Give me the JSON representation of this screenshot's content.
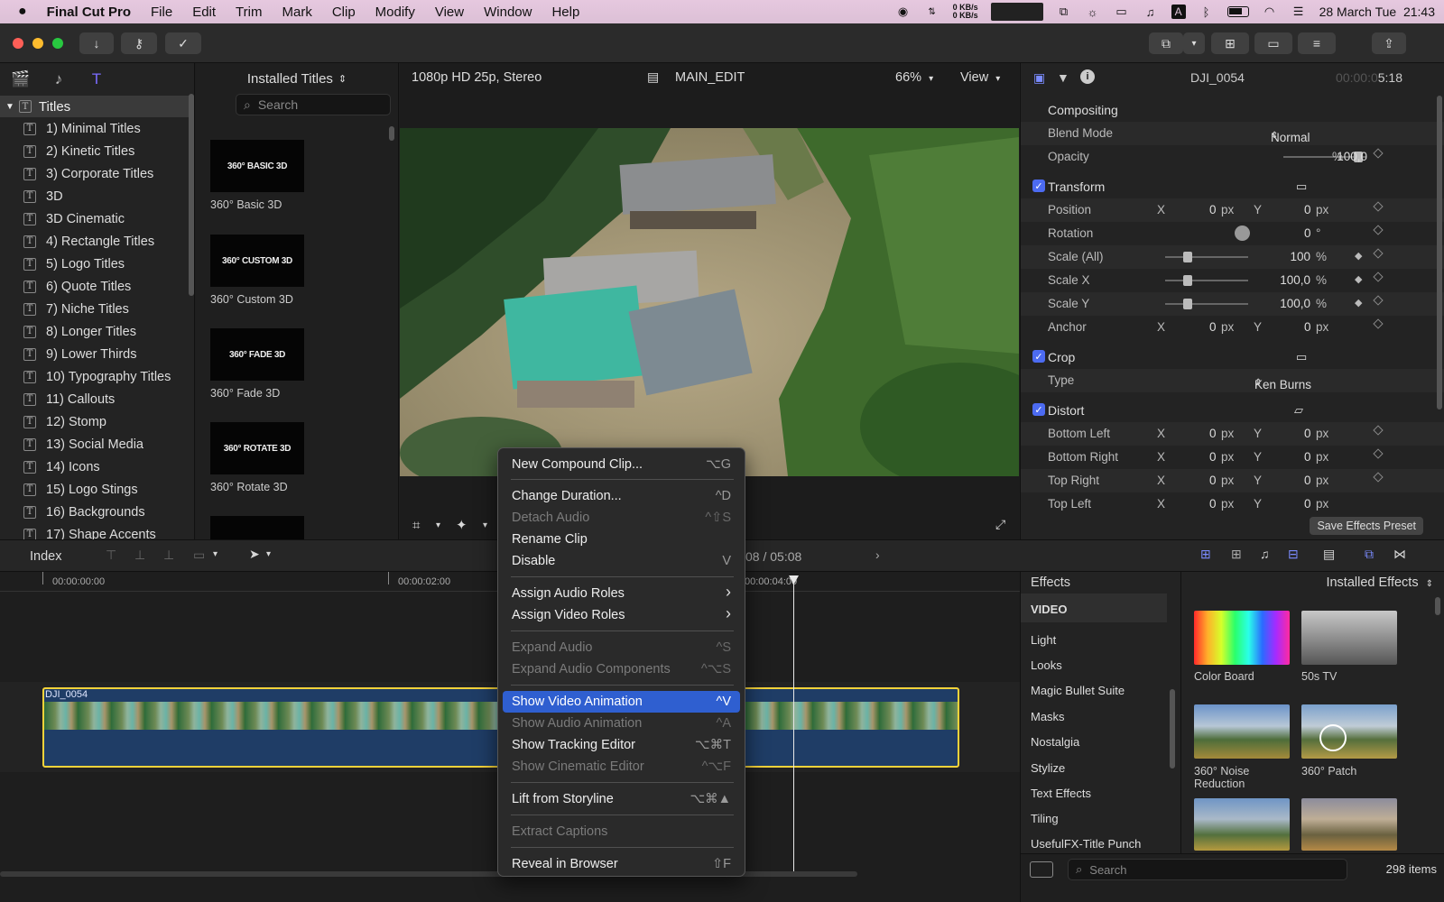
{
  "menubar": {
    "app": "Final Cut Pro",
    "items": [
      "File",
      "Edit",
      "Trim",
      "Mark",
      "Clip",
      "Modify",
      "View",
      "Window",
      "Help"
    ],
    "net_up": "0 KB/s",
    "net_down": "0 KB/s",
    "keyboard": "A",
    "datetime": "28 March Tue  21:43"
  },
  "sidebar": {
    "root": "Titles",
    "items": [
      "1) Minimal Titles",
      "2) Kinetic Titles",
      "3) Corporate Titles",
      "3D",
      "3D Cinematic",
      "4) Rectangle Titles",
      "5) Logo Titles",
      "6) Quote Titles",
      "7) Niche Titles",
      "8) Longer Titles",
      "9) Lower Thirds",
      "10) Typography Titles",
      "11) Callouts",
      "12) Stomp",
      "13) Social Media",
      "14) Icons",
      "15) Logo Stings",
      "16) Backgrounds",
      "17) Shape Accents"
    ]
  },
  "titles_browser": {
    "header": "Installed Titles",
    "search_placeholder": "Search",
    "thumbs": [
      {
        "thumb_text": "360° BASIC 3D",
        "label": "360° Basic 3D"
      },
      {
        "thumb_text": "360° CUSTOM 3D",
        "label": "360° Custom 3D"
      },
      {
        "thumb_text": "360° FADE 3D",
        "label": "360° Fade 3D"
      },
      {
        "thumb_text": "360° ROTATE 3D",
        "label": "360° Rotate 3D"
      }
    ]
  },
  "viewer": {
    "format": "1080p HD 25p, Stereo",
    "project": "MAIN_EDIT",
    "zoom": "66%",
    "view_label": "View"
  },
  "inspector": {
    "clip_name": "DJI_0054",
    "timecode_dim": "00:00:0",
    "timecode": "5:18",
    "compositing": "Compositing",
    "blend_mode_label": "Blend Mode",
    "blend_mode_value": "Normal",
    "opacity_label": "Opacity",
    "opacity_value": "100,0",
    "opacity_level": 0.9,
    "transform": "Transform",
    "position_label": "Position",
    "position_x": "0",
    "position_y": "0",
    "rotation_label": "Rotation",
    "rotation_value": "0",
    "scale_all_label": "Scale (All)",
    "scale_all_value": "100",
    "scale_x_label": "Scale X",
    "scale_x_value": "100,0",
    "scale_y_label": "Scale Y",
    "scale_y_value": "100,0",
    "anchor_label": "Anchor",
    "anchor_x": "0",
    "anchor_y": "0",
    "crop": "Crop",
    "type_label": "Type",
    "type_value": "Ken Burns",
    "distort": "Distort",
    "bottom_left": "Bottom Left",
    "bottom_right": "Bottom Right",
    "top_right": "Top Right",
    "top_left": "Top Left",
    "zero": "0",
    "x": "X",
    "y": "Y",
    "px": "px",
    "pct": "%",
    "deg": "°",
    "save_preset": "Save Effects Preset"
  },
  "timeline": {
    "index_label": "Index",
    "timecode_partial": "08 / 05:08",
    "ruler": [
      "00:00:00:00",
      "00:00:02:00",
      "00:00:04:00"
    ],
    "clip_name": "DJI_0054"
  },
  "effects": {
    "title": "Effects",
    "header": "Installed Effects",
    "categories": [
      "VIDEO",
      "Light",
      "Looks",
      "Magic Bullet Suite",
      "Masks",
      "Nostalgia",
      "Stylize",
      "Text Effects",
      "Tiling",
      "UsefulFX-Title Punch"
    ],
    "thumbs": [
      "Color Board",
      "50s TV",
      "360° Noise Reduction",
      "360° Patch"
    ],
    "search_placeholder": "Search",
    "count": "298 items"
  },
  "context_menu": {
    "items": [
      {
        "label": "New Compound Clip...",
        "shortcut": "⌥G",
        "disabled": false
      },
      {
        "label": "Change Duration...",
        "shortcut": "^D",
        "disabled": false
      },
      {
        "label": "Detach Audio",
        "shortcut": "^⇧S",
        "disabled": true
      },
      {
        "label": "Rename Clip",
        "shortcut": "",
        "disabled": false
      },
      {
        "label": "Disable",
        "shortcut": "V",
        "disabled": false
      },
      {
        "label": "Assign Audio Roles",
        "shortcut": "›",
        "disabled": false
      },
      {
        "label": "Assign Video Roles",
        "shortcut": "›",
        "disabled": false
      },
      {
        "label": "Expand Audio",
        "shortcut": "^S",
        "disabled": true
      },
      {
        "label": "Expand Audio Components",
        "shortcut": "^⌥S",
        "disabled": true
      },
      {
        "label": "Show Video Animation",
        "shortcut": "^V",
        "disabled": false
      },
      {
        "label": "Show Audio Animation",
        "shortcut": "^A",
        "disabled": true
      },
      {
        "label": "Show Tracking Editor",
        "shortcut": "⌥⌘T",
        "disabled": false
      },
      {
        "label": "Show Cinematic Editor",
        "shortcut": "^⌥F",
        "disabled": true
      },
      {
        "label": "Lift from Storyline",
        "shortcut": "⌥⌘▲",
        "disabled": false
      },
      {
        "label": "Extract Captions",
        "shortcut": "",
        "disabled": true
      },
      {
        "label": "Reveal in Browser",
        "shortcut": "⇧F",
        "disabled": false
      }
    ]
  },
  "colors": {
    "accent": "#2f5fd0",
    "clip_border": "#f5d33a",
    "clip_fill": "#1f3d66",
    "menubar": "#e0c4da",
    "checkbox": "#4c6bf1"
  }
}
